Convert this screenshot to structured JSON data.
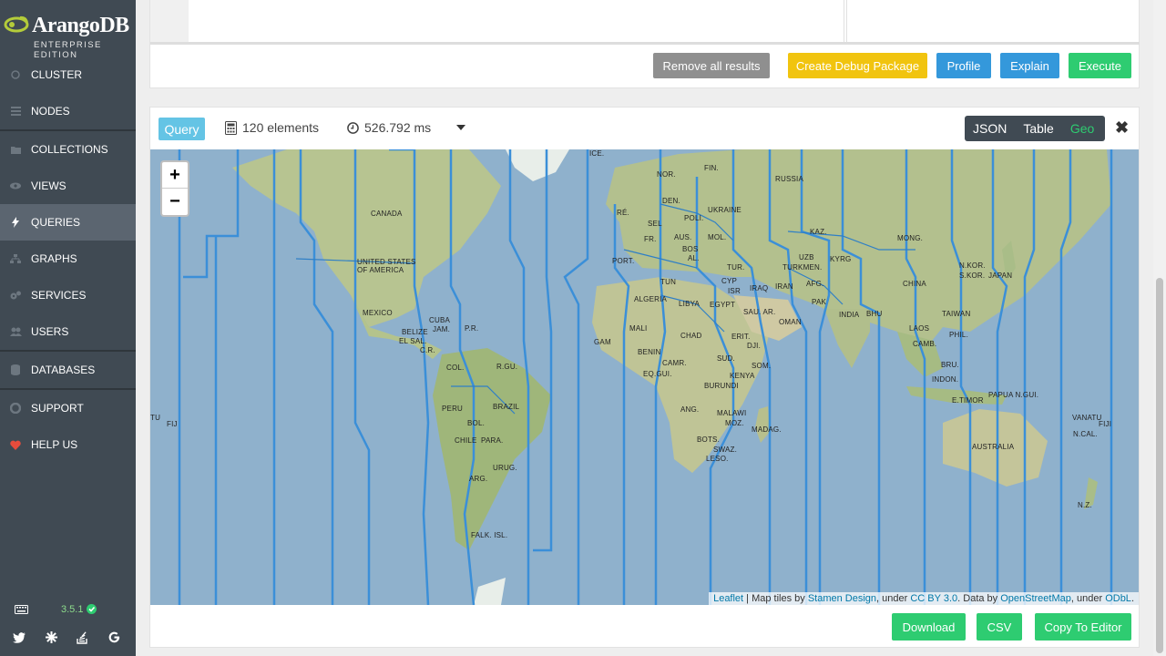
{
  "brand": {
    "name": "ArangoDB",
    "edition": "ENTERPRISE EDITION"
  },
  "sidebar": {
    "items": [
      {
        "label": "CLUSTER",
        "icon": "circle-icon"
      },
      {
        "label": "NODES",
        "icon": "server-icon"
      },
      {
        "label": "COLLECTIONS",
        "icon": "folder-icon"
      },
      {
        "label": "VIEWS",
        "icon": "eye-icon"
      },
      {
        "label": "QUERIES",
        "icon": "bolt-icon",
        "active": true
      },
      {
        "label": "GRAPHS",
        "icon": "sitemap-icon"
      },
      {
        "label": "SERVICES",
        "icon": "cogs-icon"
      },
      {
        "label": "USERS",
        "icon": "users-icon"
      },
      {
        "label": "DATABASES",
        "icon": "database-icon"
      },
      {
        "label": "SUPPORT",
        "icon": "life-ring-icon"
      },
      {
        "label": "HELP US",
        "icon": "heart-icon"
      }
    ],
    "version": "3.5.1",
    "social": [
      "twitter-icon",
      "slack-icon",
      "stackoverflow-icon",
      "google-icon"
    ]
  },
  "query_actions": {
    "remove": "Remove all results",
    "debug": "Create Debug Package",
    "profile": "Profile",
    "explain": "Explain",
    "execute": "Execute"
  },
  "results": {
    "badge": "Query",
    "elements": "120 elements",
    "time": "526.792 ms",
    "modes": [
      "JSON",
      "Table",
      "Geo"
    ],
    "active_mode": "Geo",
    "close": "✖"
  },
  "map": {
    "zoom_in": "+",
    "zoom_out": "−",
    "attribution": {
      "leaflet": "Leaflet",
      "tiles_prefix": " | Map tiles by ",
      "stamen": "Stamen Design",
      "under1": ", under ",
      "ccby": "CC BY 3.0",
      "data_by": ". Data by ",
      "osm": "OpenStreetMap",
      "under2": ", under ",
      "odbl": "ODbL",
      "end": "."
    },
    "labels": [
      "ICE.",
      "NOR.",
      "FIN.",
      "RUSSIA",
      "DEN.",
      "POLI.",
      "UKRAINE",
      "MOL.",
      "FR.",
      "AUS.",
      "SEL",
      "RÉ.",
      "BOS",
      "AL.",
      "PORT.",
      "TUR.",
      "KAZ.",
      "MONG.",
      "CANADA",
      "UNITED STATES OF AMERICA",
      "TUN",
      "CYP",
      "ISR",
      "IRAQ",
      "IRAN",
      "UZB",
      "TURKMEN.",
      "AFG.",
      "KYRG",
      "PAK",
      "N.KOR.",
      "S.KOR.",
      "JAPAN",
      "CHINA",
      "ALGERIA",
      "LIBYA",
      "EGYPT",
      "SAU. AR.",
      "OMAN",
      "INDIA",
      "BHU",
      "TAIWAN",
      "MEXICO",
      "CUBA",
      "JAM.",
      "P.R.",
      "BELIZE",
      "EL SAL.",
      "C.R.",
      "MALI",
      "CHAD",
      "ERIT.",
      "DJI.",
      "LAOS",
      "CAMB.",
      "PHIL.",
      "GAM",
      "BENIN",
      "CAMR.",
      "SUD.",
      "SOM.",
      "KENYA",
      "COL.",
      "R.GU.",
      "PERU",
      "BRAZIL",
      "BOL.",
      "CHILE",
      "PARA.",
      "URUG.",
      "ARG.",
      "FALK. ISL.",
      "EQ.GUI.",
      "BURUNDI",
      "ANG.",
      "MALAWI",
      "MOZ.",
      "MADAG.",
      "BOTS.",
      "SWAZ.",
      "LESO.",
      "BRU.",
      "INDON.",
      "PAPUA N.GUI.",
      "E.TIMOR",
      "AUSTRALIA",
      "VANATU",
      "N.CAL.",
      "FIJI",
      "N.Z.",
      "TU",
      "FIJ"
    ]
  },
  "export": {
    "download": "Download",
    "csv": "CSV",
    "copy": "Copy To Editor"
  }
}
